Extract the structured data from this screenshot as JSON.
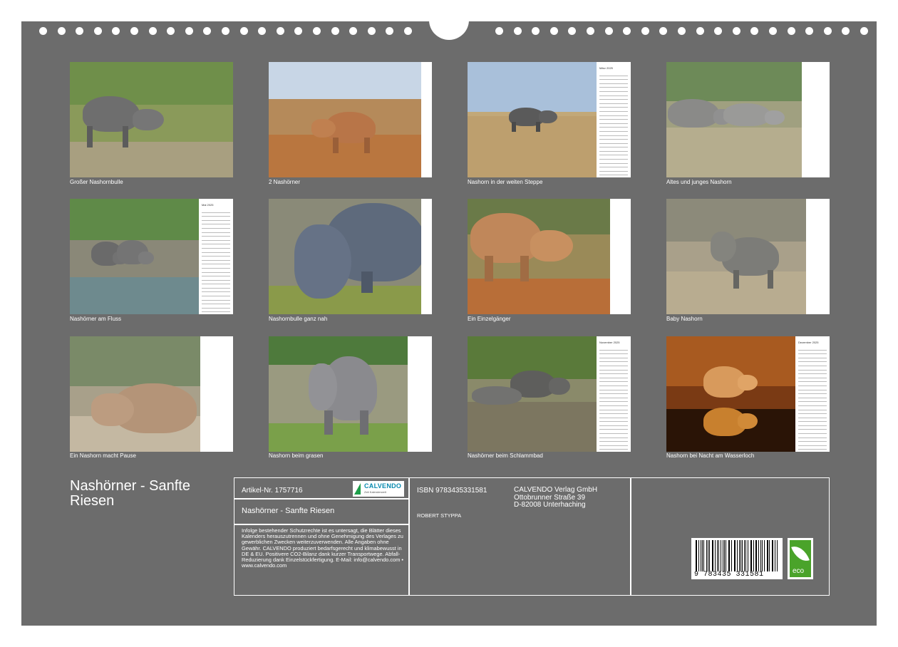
{
  "tiles": [
    {
      "caption": "Großer Nashornbulle",
      "calendar": false
    },
    {
      "caption": "2 Nashörner",
      "calendar": false
    },
    {
      "caption": "Nashorn in der weiten Steppe",
      "calendar": true,
      "month": "März 2025"
    },
    {
      "caption": "Altes und junges Nashorn",
      "calendar": false
    },
    {
      "caption": "Nashörner am Fluss",
      "calendar": true,
      "month": "Mai 2025"
    },
    {
      "caption": "Nashornbulle ganz nah",
      "calendar": false
    },
    {
      "caption": "Ein Einzelgänger",
      "calendar": false
    },
    {
      "caption": "Baby Nashorn",
      "calendar": false
    },
    {
      "caption": "Ein Nashorn macht Pause",
      "calendar": false
    },
    {
      "caption": "Nashorn beim grasen",
      "calendar": false
    },
    {
      "caption": "Nashörner beim Schlammbad",
      "calendar": true,
      "month": "November 2025"
    },
    {
      "caption": "Nashorn bei Nacht am Wasserloch",
      "calendar": true,
      "month": "Dezember 2025"
    }
  ],
  "title": "Nashörner - Sanfte Riesen",
  "info": {
    "article": "Artikel-Nr. 1757716",
    "logo_text": "CALVENDO",
    "logo_sub": "Zeit Kalenderwelt",
    "subtitle": "Nashörner - Sanfte Riesen",
    "legal": "Infolge bestehender Schutzrechte ist es untersagt, die Blätter dieses Kalenders herauszutrennen und ohne Genehmigung des Verlages zu gewerblichen Zwecken weiterzuverwenden. Alle Angaben ohne Gewähr. CALVENDO produziert bedarfsgerecht und klimabewusst in DE & EU. Positivere CO2-Bilanz dank kurzer Transportwege. Abfall-Reduzierung dank Einzelstückfertigung. E-Mail: info@calvendo.com • www.calvendo.com",
    "isbn": "ISBN 9783435331581",
    "author": "ROBERT STYPPA",
    "publisher_name": "CALVENDO Verlag GmbH",
    "publisher_street": "Ottobrunner Straße 39",
    "publisher_city": "D-82008 Unterhaching",
    "barcode_number": "9 783435 331581",
    "eco_label": "eco"
  },
  "colors": {
    "board": "#6c6c6c",
    "text": "#ffffff",
    "eco_green": "#4aa32a"
  }
}
